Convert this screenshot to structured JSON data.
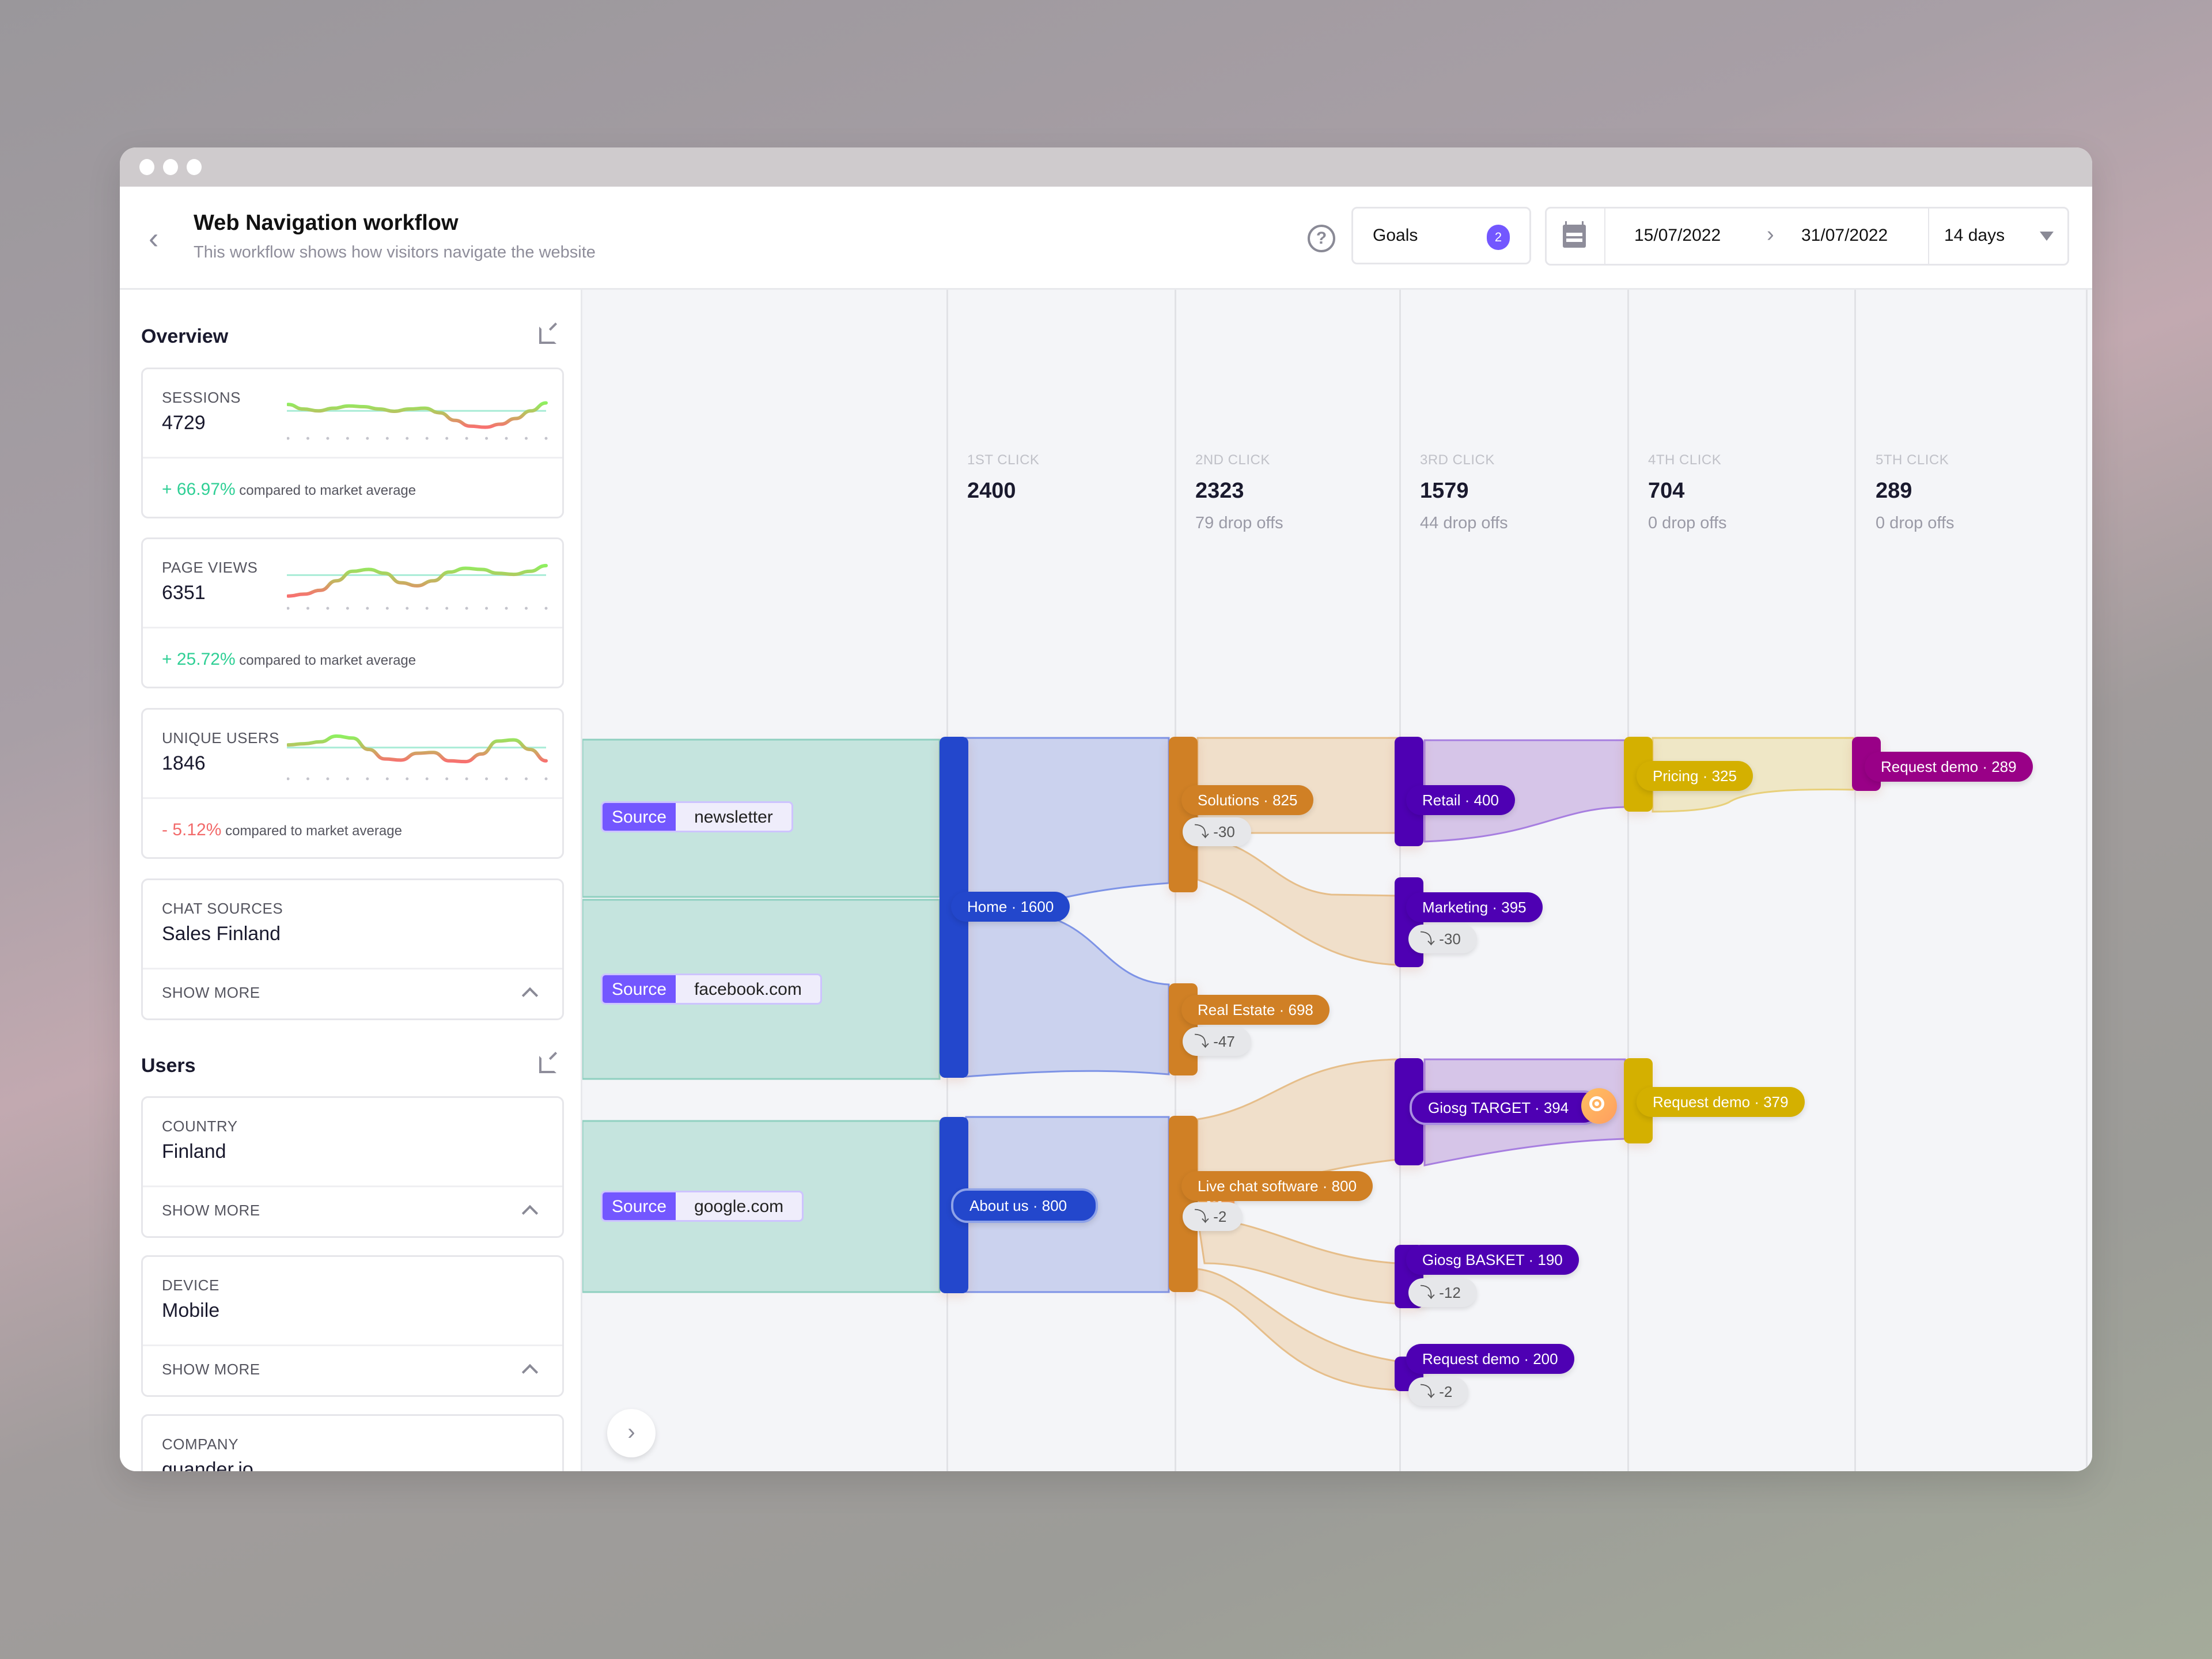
{
  "window": {
    "controls": [
      "close",
      "minimize",
      "maximize"
    ]
  },
  "header": {
    "title": "Web Navigation workflow",
    "subtitle": "This workflow shows how visitors navigate the website",
    "back_icon": "chevron-left-icon",
    "help_icon": "question-circle-icon",
    "goals": {
      "label": "Goals",
      "count": "2"
    },
    "date_from": "15/07/2022",
    "date_to": "31/07/2022",
    "range": "14 days"
  },
  "sidebar": {
    "overview_title": "Overview",
    "users_title": "Users",
    "metrics": [
      {
        "label": "SESSIONS",
        "value": "4729",
        "change_sign": "+",
        "change": "66.97%",
        "compare": "compared to market average",
        "trend": "positive",
        "spark": [
          0.62,
          0.5,
          0.45,
          0.52,
          0.58,
          0.56,
          0.5,
          0.44,
          0.5,
          0.52,
          0.4,
          0.2,
          0.05,
          0.02,
          0.1,
          0.25,
          0.45,
          0.66
        ],
        "baseline": 0.45
      },
      {
        "label": "PAGE VIEWS",
        "value": "6351",
        "change_sign": "+",
        "change": "25.72%",
        "compare": "compared to market average",
        "trend": "positive",
        "spark": [
          0.05,
          0.1,
          0.2,
          0.45,
          0.7,
          0.75,
          0.65,
          0.4,
          0.32,
          0.45,
          0.68,
          0.78,
          0.75,
          0.65,
          0.62,
          0.7,
          0.85
        ],
        "baseline": 0.6
      },
      {
        "label": "UNIQUE USERS",
        "value": "1846",
        "change_sign": "-",
        "change": "5.12%",
        "compare": "compared to market average",
        "trend": "negative",
        "spark": [
          0.62,
          0.65,
          0.7,
          0.85,
          0.8,
          0.5,
          0.25,
          0.22,
          0.4,
          0.42,
          0.2,
          0.18,
          0.38,
          0.72,
          0.75,
          0.5,
          0.2
        ],
        "baseline": 0.55
      }
    ],
    "chat_sources": {
      "label": "CHAT SOURCES",
      "value": "Sales Finland",
      "show_more": "SHOW MORE"
    },
    "users": [
      {
        "label": "COUNTRY",
        "value": "Finland",
        "show_more": "SHOW MORE"
      },
      {
        "label": "DEVICE",
        "value": "Mobile",
        "show_more": "SHOW MORE"
      },
      {
        "label": "COMPANY",
        "value": "quander.io"
      }
    ]
  },
  "flow": {
    "columns": [
      {
        "label": "1ST CLICK",
        "count": "2400",
        "dropoffs": ""
      },
      {
        "label": "2ND CLICK",
        "count": "2323",
        "dropoffs": "79 drop offs"
      },
      {
        "label": "3RD CLICK",
        "count": "1579",
        "dropoffs": "44 drop offs"
      },
      {
        "label": "4TH CLICK",
        "count": "704",
        "dropoffs": "0 drop offs"
      },
      {
        "label": "5TH CLICK",
        "count": "289",
        "dropoffs": "0 drop offs"
      }
    ],
    "sources": [
      {
        "tag": "Source",
        "name": "newsletter"
      },
      {
        "tag": "Source",
        "name": "facebook.com"
      },
      {
        "tag": "Source",
        "name": "google.com"
      }
    ],
    "nodes": [
      {
        "label": "Home · 1600",
        "color": "#2347cc"
      },
      {
        "label": "About us · 800",
        "color": "#2347cc",
        "goal": true
      },
      {
        "label": "Solutions · 825",
        "color": "#d08025",
        "drop": "-30"
      },
      {
        "label": "Real Estate · 698",
        "color": "#d08025",
        "drop": "-47"
      },
      {
        "label": "Live chat software · 800",
        "color": "#d08025",
        "drop": "-2"
      },
      {
        "label": "Retail · 400",
        "color": "#4e00b3"
      },
      {
        "label": "Marketing · 395",
        "color": "#4e00b3",
        "drop": "-30"
      },
      {
        "label": "Giosg TARGET · 394",
        "color": "#4e00b3",
        "goal": true
      },
      {
        "label": "Giosg BASKET · 190",
        "color": "#4e00b3",
        "drop": "-12"
      },
      {
        "label": "Request demo · 200",
        "color": "#4e00b3",
        "drop": "-2"
      },
      {
        "label": "Pricing · 325",
        "color": "#d4b000"
      },
      {
        "label": "Request demo · 379",
        "color": "#d4b000"
      },
      {
        "label": "Request demo · 289",
        "color": "#990087"
      }
    ]
  },
  "colors": {
    "accent": "#7357ff",
    "positive": "#2fcf95",
    "negative": "#f26a6a",
    "source_flow": "#c5e4de",
    "click1_flow": "#cbd2ee",
    "click2_flow": "#f0dfca",
    "click3_flow": "#d6c5e8",
    "click4_flow": "#efe7c6"
  }
}
